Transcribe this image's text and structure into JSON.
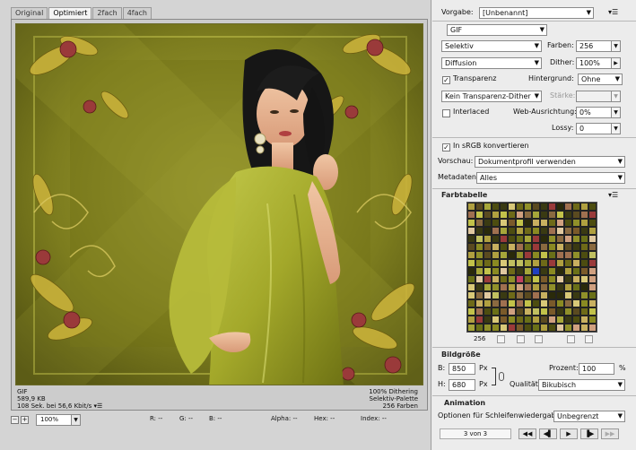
{
  "tabs": [
    "Original",
    "Optimiert",
    "2fach",
    "4fach"
  ],
  "info": {
    "format": "GIF",
    "size": "589,9 KB",
    "time": "108 Sek. bei 56,6 Kbit/s",
    "dithering": "100% Dithering",
    "palette": "Selektiv-Palette",
    "colors": "256 Farben"
  },
  "statusbar": {
    "zoom": "100%",
    "r": "R: --",
    "g": "G: --",
    "b": "B: --",
    "alpha": "Alpha: --",
    "hex": "Hex: --",
    "index": "Index: --"
  },
  "settings": {
    "vorgabe_label": "Vorgabe:",
    "vorgabe_value": "[Unbenannt]",
    "format": "GIF",
    "reduction": "Selektiv",
    "farben_label": "Farben:",
    "farben_value": "256",
    "dither_algo": "Diffusion",
    "dither_label": "Dither:",
    "dither_value": "100%",
    "transparenz_label": "Transparenz",
    "hintergrund_label": "Hintergrund:",
    "hintergrund_value": "Ohne",
    "trans_dither": "Kein Transparenz-Dither",
    "staerke_label": "Stärke:",
    "interlaced_label": "Interlaced",
    "webausrichtung_label": "Web-Ausrichtung:",
    "webausrichtung_value": "0%",
    "lossy_label": "Lossy:",
    "lossy_value": "0",
    "srgb_label": "In sRGB konvertieren",
    "vorschau_label": "Vorschau:",
    "vorschau_value": "Dokumentprofil verwenden",
    "metadaten_label": "Metadaten:",
    "metadaten_value": "Alles"
  },
  "farbtabelle": {
    "title": "Farbtabelle",
    "count": "256"
  },
  "bildgroesse": {
    "title": "Bildgröße",
    "b_label": "B:",
    "b_value": "850",
    "h_label": "H:",
    "h_value": "680",
    "unit": "Px",
    "prozent_label": "Prozent:",
    "prozent_value": "100",
    "prozent_unit": "%",
    "qualitaet_label": "Qualität:",
    "qualitaet_value": "Bikubisch"
  },
  "animation": {
    "title": "Animation",
    "loop_label": "Optionen für Schleifenwiedergabe:",
    "loop_value": "Unbegrenzt",
    "frame_counter": "3 von 3"
  },
  "colors": {
    "bg_olive": "#8a8a22",
    "dress": "#a8b030",
    "panel": "#ececec"
  }
}
